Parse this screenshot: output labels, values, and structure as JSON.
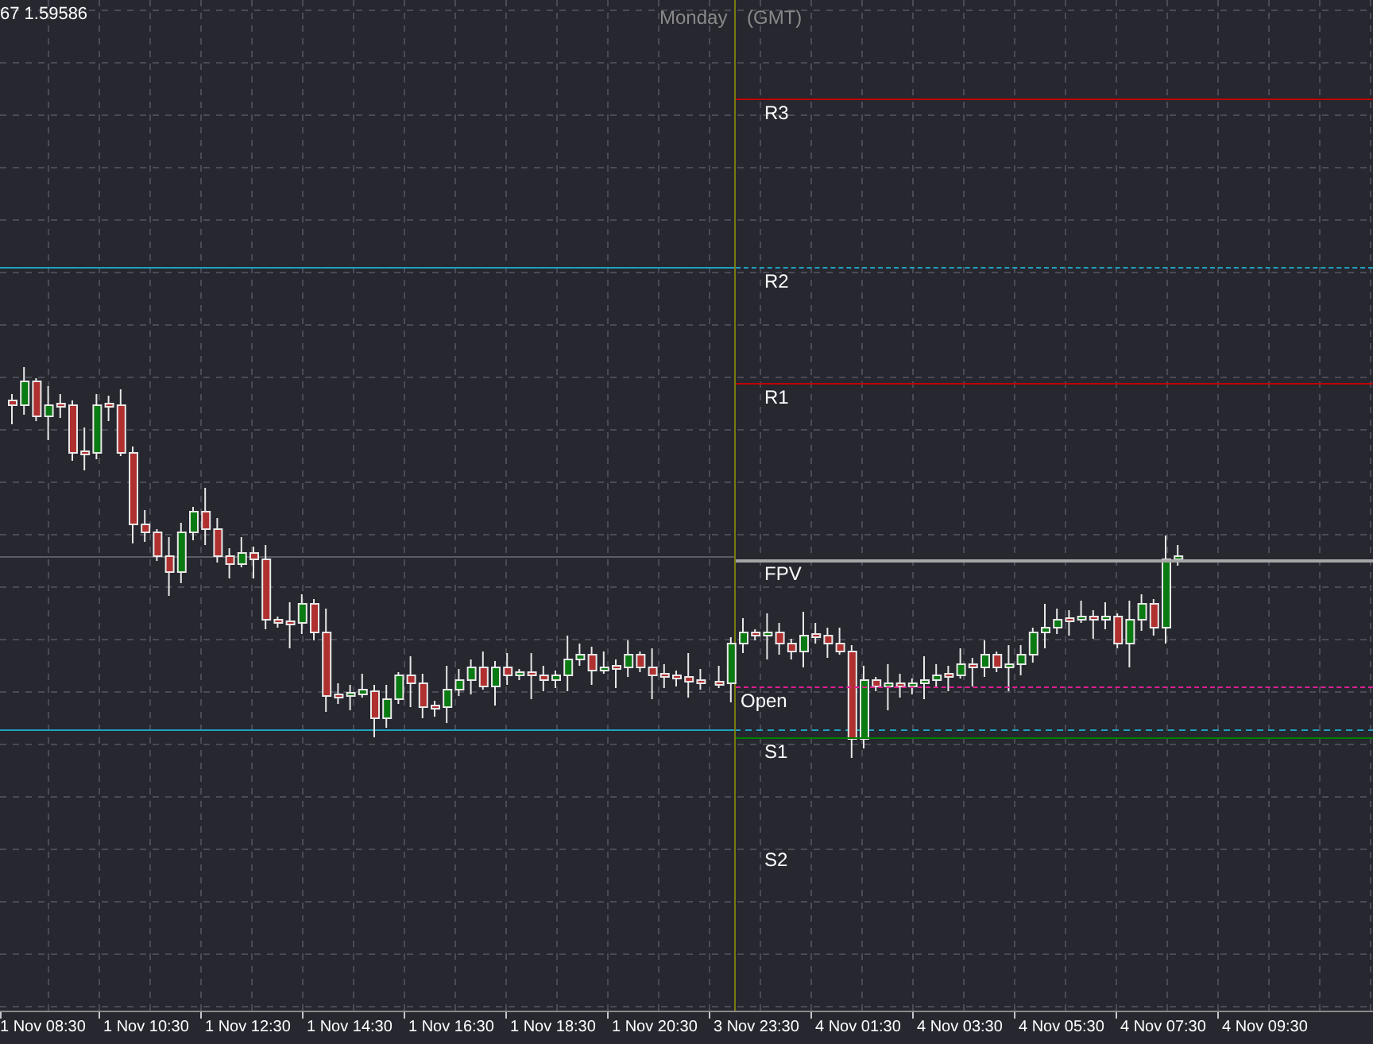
{
  "header": {
    "price_readout": "67 1.59586",
    "day_label": "Monday",
    "timezone_label": "(GMT)"
  },
  "levels": [
    {
      "label": "R3",
      "color": "#c00000",
      "kind": "solid"
    },
    {
      "label": "R2",
      "color": "#1fa2c0",
      "kind": "dashed"
    },
    {
      "label": "R1",
      "color": "#c00000",
      "kind": "solid"
    },
    {
      "label": "FPV",
      "color": "#a6a6a6",
      "kind": "thick"
    },
    {
      "label": "Open",
      "color": "#e0208f",
      "kind": "dashed"
    },
    {
      "label": "S1",
      "color": "#008000",
      "kind": "solid"
    },
    {
      "label": "S2"
    }
  ],
  "time_axis": [
    "1 Nov 08:30",
    "1 Nov 10:30",
    "1 Nov 12:30",
    "1 Nov 14:30",
    "1 Nov 16:30",
    "1 Nov 18:30",
    "1 Nov 20:30",
    "3 Nov 23:30",
    "4 Nov 01:30",
    "4 Nov 03:30",
    "4 Nov 05:30",
    "4 Nov 07:30",
    "4 Nov 09:30"
  ]
}
